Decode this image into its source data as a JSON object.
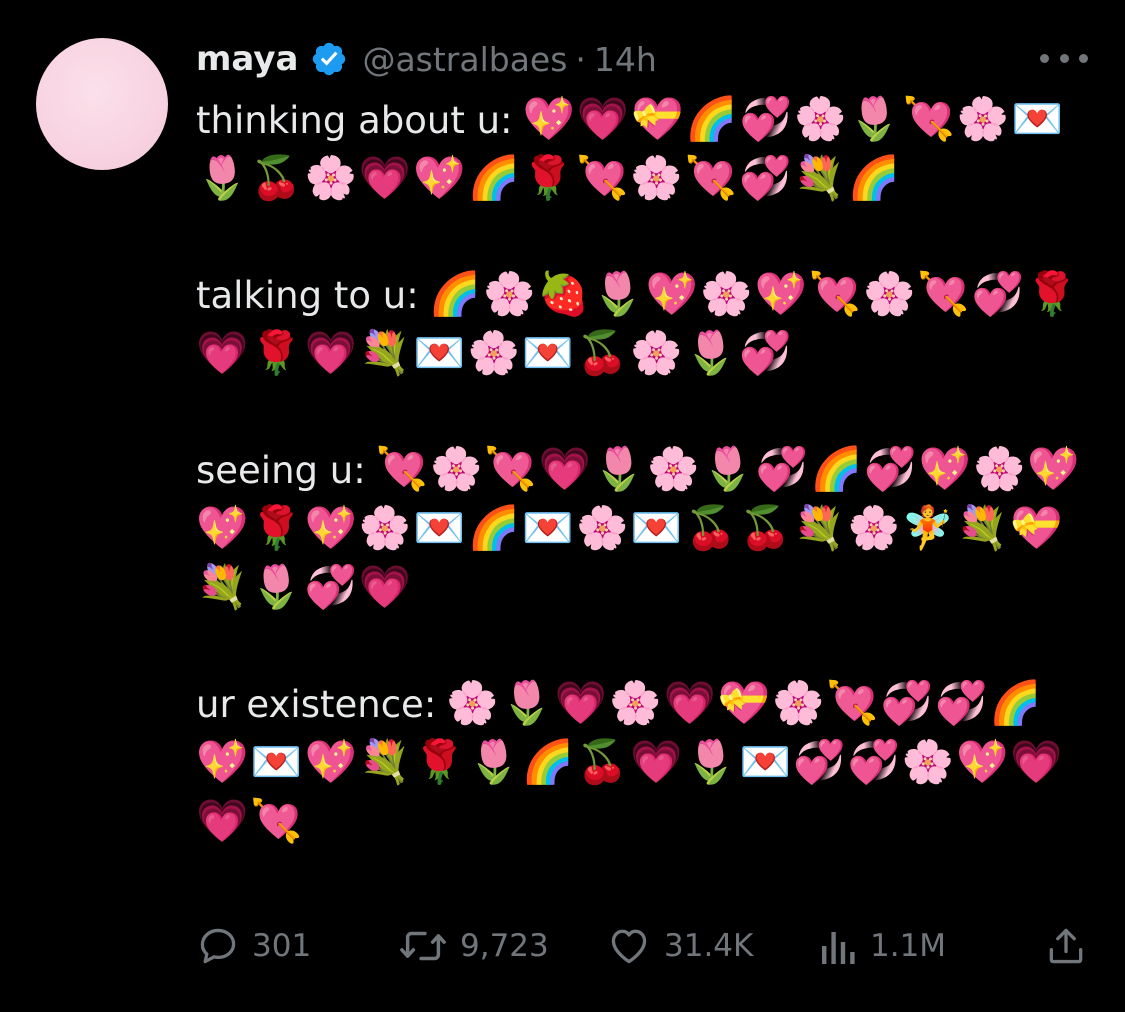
{
  "author": {
    "display_name": "maya",
    "handle": "@astralbaes",
    "separator": "·",
    "timestamp": "14h",
    "avatar_color": "#f8d3e1",
    "verified_color": "#1d9bf0"
  },
  "body": {
    "paragraphs": [
      {
        "label": "thinking about u:",
        "emojis": "💖💗💝🌈💞🌸🌷💘🌸💌🌷🍒🌸💗💖🌈🌹💘🌸💘💞💐🌈"
      },
      {
        "label": "talking to u:",
        "emojis": "🌈🌸🍓🌷💖🌸💖💘🌸💘💞🌹💗🌹💗💐💌🌸💌🍒🌸🌷💞"
      },
      {
        "label": "seeing u:",
        "emojis": "💘🌸💘💗🌷🌸🌷💞🌈💞💖🌸💖💖🌹💖🌸💌🌈💌🌸💌🍒🍒💐🌸🧚💐💝💐🌷💞💗"
      },
      {
        "label": "ur existence:",
        "emojis": "🌸🌷💗🌸💗💝🌸💘💞💞🌈💖💌💖💐🌹🌷🌈🍒💗🌷💌💞💞🌸💖💗💗💘"
      }
    ]
  },
  "actions": {
    "reply_count": "301",
    "retweet_count": "9,723",
    "like_count": "31.4K",
    "views_count": "1.1M",
    "icons": [
      "reply-icon",
      "retweet-icon",
      "like-icon",
      "views-icon",
      "share-icon"
    ]
  },
  "more_icon": "more-options-icon"
}
